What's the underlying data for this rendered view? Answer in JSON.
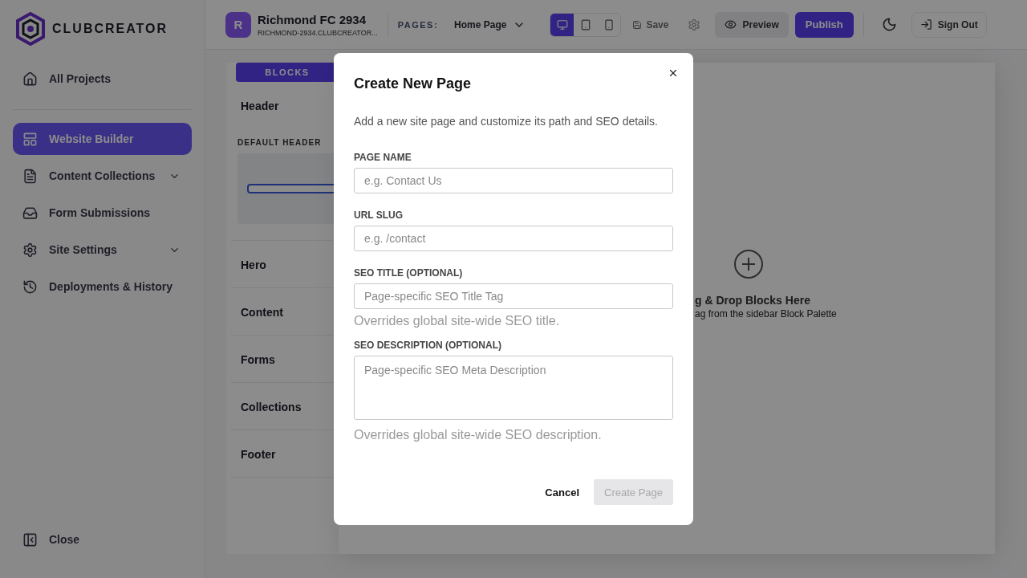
{
  "sidebar": {
    "logo": "CLUBCREATOR",
    "top_item": {
      "label": "All Projects",
      "selected": false
    },
    "items": [
      {
        "label": "Website Builder",
        "selected": true,
        "kind": "builder"
      },
      {
        "label": "Content Collections",
        "selected": false,
        "kind": "collections"
      },
      {
        "label": "Form Submissions",
        "selected": false,
        "kind": "forms"
      },
      {
        "label": "Site Settings",
        "selected": false,
        "kind": "settings"
      },
      {
        "label": "Deployments & History",
        "selected": false,
        "kind": "history"
      }
    ],
    "close": "Close"
  },
  "topbar": {
    "project": {
      "initial": "R",
      "name": "Richmond FC 2934",
      "domain": "RICHMOND-2934.CLUBCREATOR..."
    },
    "pages_label": "PAGES:",
    "page_select": "Home Page",
    "view_modes": [
      {
        "kind": "desktop",
        "selected": true
      },
      {
        "kind": "tablet",
        "selected": false
      },
      {
        "kind": "mobile",
        "selected": false
      }
    ],
    "save": {
      "label": "Save",
      "disabled": true
    },
    "preview": "Preview",
    "publish": "Publish",
    "sign_out": "Sign Out"
  },
  "blocks_panel": {
    "tab": "BLOCKS",
    "categories": [
      {
        "label": "Header",
        "section": "DEFAULT HEADER"
      },
      {
        "label": "Hero"
      },
      {
        "label": "Content"
      },
      {
        "label": "Forms"
      },
      {
        "label": "Collections"
      },
      {
        "label": "Footer"
      }
    ]
  },
  "canvas": {
    "title": "g & Drop Blocks Here",
    "hint": "ag from the sidebar Block Palette"
  },
  "dialog": {
    "title": "Create New Page",
    "description": "Add a new site page and customize its path and SEO details.",
    "fields": [
      {
        "kind": "input",
        "label": "PAGE NAME",
        "placeholder": "e.g. Contact Us"
      },
      {
        "kind": "input",
        "label": "URL SLUG",
        "placeholder": "e.g. /contact"
      },
      {
        "kind": "input",
        "label": "SEO TITLE (OPTIONAL)",
        "placeholder": "Page-specific SEO Title Tag",
        "help": "Overrides global site-wide SEO title."
      },
      {
        "kind": "textarea",
        "label": "SEO DESCRIPTION (OPTIONAL)",
        "placeholder": "Page-specific SEO Meta Description",
        "help": "Overrides global site-wide SEO description."
      }
    ],
    "cancel": "Cancel",
    "submit": {
      "label": "Create Page",
      "disabled": true
    }
  }
}
